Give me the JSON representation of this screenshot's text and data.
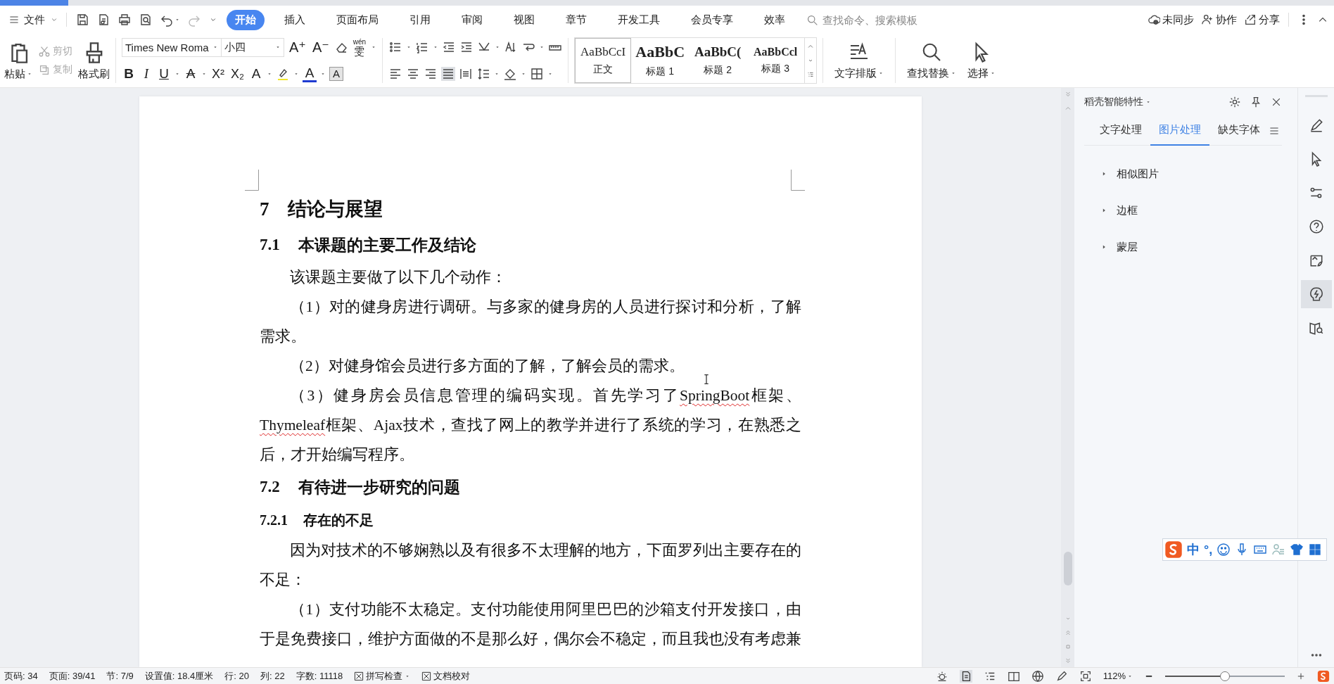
{
  "menu": {
    "file": "文件",
    "tabs": [
      {
        "label": "开始",
        "selected": true
      },
      {
        "label": "插入",
        "selected": false
      },
      {
        "label": "页面布局",
        "selected": false
      },
      {
        "label": "引用",
        "selected": false
      },
      {
        "label": "审阅",
        "selected": false
      },
      {
        "label": "视图",
        "selected": false
      },
      {
        "label": "章节",
        "selected": false
      },
      {
        "label": "开发工具",
        "selected": false
      },
      {
        "label": "会员专享",
        "selected": false
      },
      {
        "label": "效率",
        "selected": false
      }
    ],
    "search": {
      "placeholder": "查找命令、搜索模板"
    },
    "actions": [
      "未同步",
      "协作",
      "分享"
    ]
  },
  "ribbon": {
    "clipboard": {
      "paste": "粘贴",
      "cut": {
        "label": "剪切",
        "disabled": true
      },
      "copy": {
        "label": "复制",
        "disabled": true
      },
      "format_painter": "格式刷"
    },
    "font": {
      "name": "Times New Roma",
      "size": "小四",
      "size_buttons": [
        "A⁺",
        "A⁻"
      ],
      "phonetic": {
        "ruby": "wén",
        "char": "雯"
      },
      "format_buttons": [
        {
          "label": "B",
          "kind": "bold"
        },
        {
          "label": "I",
          "kind": "italic"
        },
        {
          "label": "U",
          "kind": "underline"
        },
        {
          "label": "A",
          "kind": "strike"
        },
        {
          "label": "X²",
          "kind": "superscript"
        },
        {
          "label": "X₂",
          "kind": "subscript"
        },
        {
          "label": "A",
          "kind": "effect"
        },
        {
          "label": "A",
          "kind": "color"
        },
        {
          "label": "A",
          "kind": "shading"
        }
      ]
    },
    "styles": [
      {
        "preview": "AaBbCcI",
        "label": "正文",
        "kind": "normal"
      },
      {
        "preview": "AaBbC",
        "label": "标题 1",
        "kind": "h1"
      },
      {
        "preview": "AaBbC(",
        "label": "标题 2",
        "kind": "h2"
      },
      {
        "preview": "AaBbCcl",
        "label": "标题 3",
        "kind": "h3"
      }
    ],
    "tools": [
      "文字排版",
      "查找替换",
      "选择"
    ]
  },
  "document": {
    "blocks": [
      {
        "kind": "h1",
        "num": "7",
        "text": "结论与展望"
      },
      {
        "kind": "h2",
        "num": "7.1",
        "text": "本课题的主要工作及结论"
      },
      {
        "kind": "p",
        "text": "该课题主要做了以下几个动作："
      },
      {
        "kind": "p",
        "text": "（1）对的健身房进行调研。与多家的健身房的人员进行探讨和分析，了解需求。"
      },
      {
        "kind": "p",
        "text": "（2）对健身馆会员进行多方面的了解，了解会员的需求。"
      },
      {
        "kind": "p",
        "segments": [
          {
            "text": "（3）健身房会员信息管理的编码实现。首先学习了",
            "misspelled": false
          },
          {
            "text": "SpringBoot",
            "misspelled": true
          },
          {
            "text": "框架、",
            "misspelled": false
          },
          {
            "text": "Thymeleaf",
            "misspelled": true
          },
          {
            "text": "框架、Ajax技术，查找了网上的教学并进行了系统的学习，在熟悉之后，才开始编写程序。",
            "misspelled": false
          }
        ]
      },
      {
        "kind": "h2",
        "num": "7.2",
        "text": "有待进一步研究的问题"
      },
      {
        "kind": "h3",
        "num": "7.2.1",
        "text": "存在的不足"
      },
      {
        "kind": "p",
        "text": "因为对技术的不够娴熟以及有很多不太理解的地方，下面罗列出主要存在的不足："
      },
      {
        "kind": "p",
        "text": "（1）支付功能不太稳定。支付功能使用阿里巴巴的沙箱支付开发接口，由于是免费接口，维护方面做的不是那么好，偶尔会不稳定，而且我也没有考虑兼"
      }
    ]
  },
  "side_panel": {
    "title": "稻壳智能特性",
    "tabs": [
      {
        "label": "文字处理",
        "selected": false
      },
      {
        "label": "图片处理",
        "selected": true
      },
      {
        "label": "缺失字体",
        "selected": false
      }
    ],
    "items": [
      {
        "label": "相似图片",
        "expanded": false
      },
      {
        "label": "边框",
        "expanded": false
      },
      {
        "label": "蒙层",
        "expanded": false
      }
    ]
  },
  "side_toolbar": [
    {
      "selected": false
    },
    {
      "selected": false
    },
    {
      "selected": false
    },
    {
      "selected": false
    },
    {
      "selected": false
    },
    {
      "selected": true
    },
    {
      "selected": false
    }
  ],
  "ime_bar": {
    "mode": "中",
    "punctuation": "°,"
  },
  "status_bar": {
    "items": [
      "页码: 34",
      "页面: 39/41",
      "节: 7/9",
      "设置值: 18.4厘米",
      "行: 20",
      "列: 22",
      "字数: 11118"
    ],
    "checks": [
      "拼写检查",
      "文档校对"
    ],
    "zoom": {
      "reading": "112%",
      "level": 0.5
    }
  }
}
